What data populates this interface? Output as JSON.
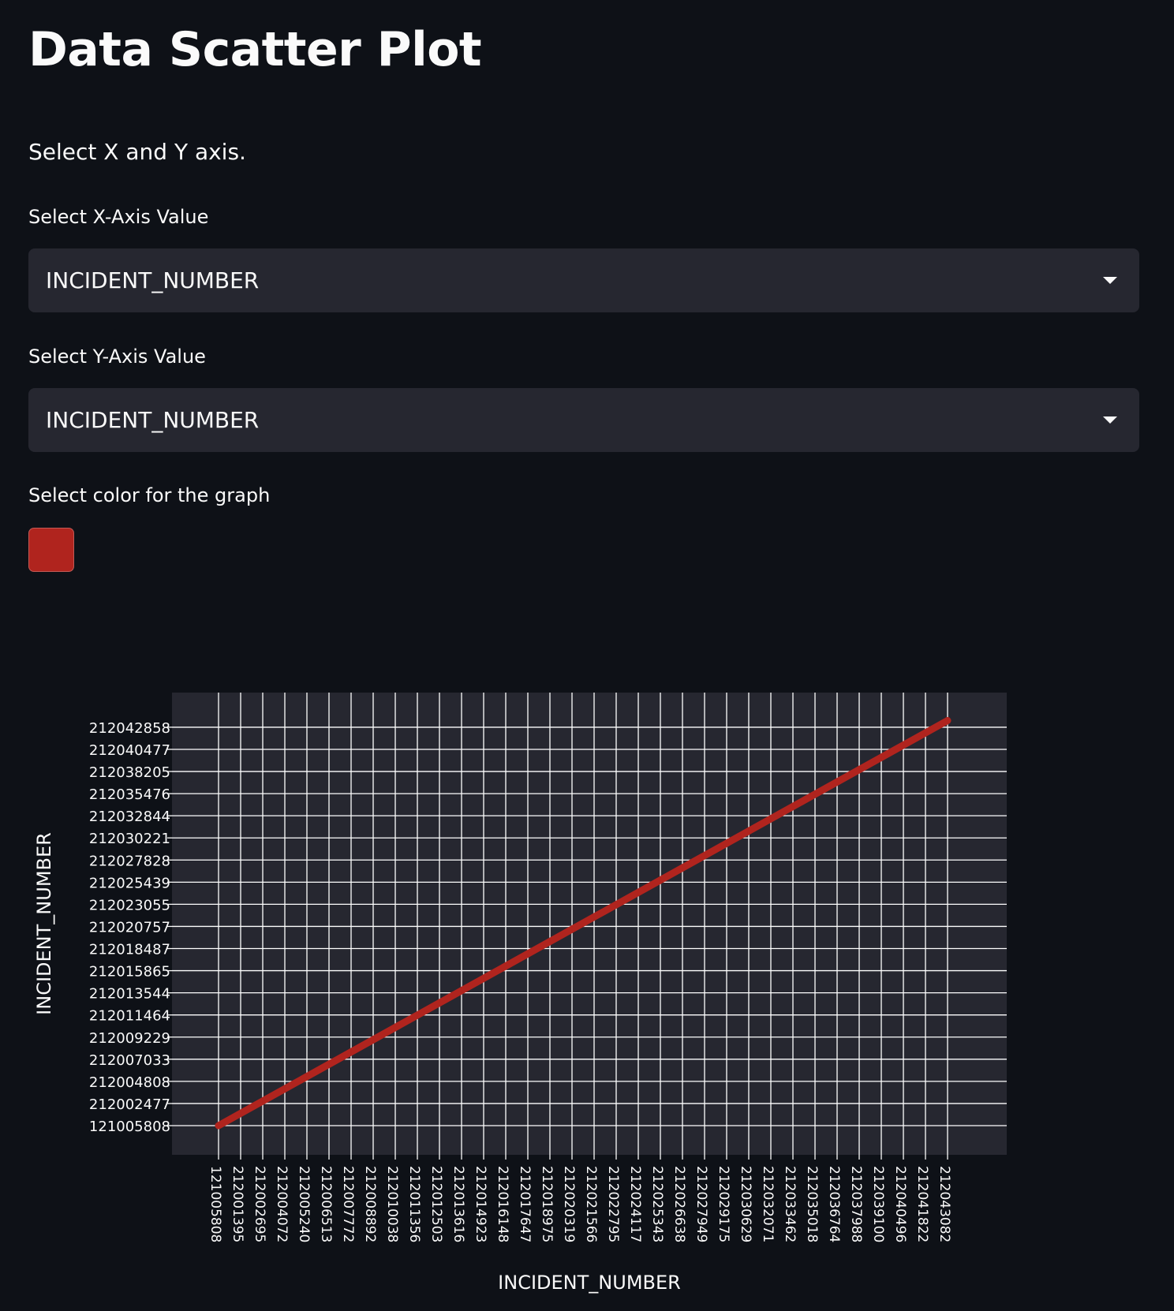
{
  "page": {
    "title": "Data Scatter Plot",
    "instruction": "Select X and Y axis."
  },
  "controls": {
    "x_axis": {
      "label": "Select X-Axis Value",
      "selected": "INCIDENT_NUMBER"
    },
    "y_axis": {
      "label": "Select Y-Axis Value",
      "selected": "INCIDENT_NUMBER"
    },
    "color": {
      "label": "Select color for the graph",
      "value": "#b0241e"
    },
    "chevron_icon": "chevron-down-icon"
  },
  "colors": {
    "background": "#0e1117",
    "panel": "#262730",
    "text": "#fafafa",
    "grid": "#ffffff",
    "series": "#b0241e"
  },
  "chart_data": {
    "type": "line",
    "xlabel": "INCIDENT_NUMBER",
    "ylabel": "INCIDENT_NUMBER",
    "grid": true,
    "legend": "none",
    "x_categories": [
      "121005808",
      "212001395",
      "212002695",
      "212004072",
      "212005240",
      "212006513",
      "212007772",
      "212008892",
      "212010038",
      "212011356",
      "212012503",
      "212013616",
      "212014923",
      "212016148",
      "212017647",
      "212018975",
      "212020319",
      "212021566",
      "212022795",
      "212024117",
      "212025343",
      "212026638",
      "212027949",
      "212029175",
      "212030629",
      "212032071",
      "212033462",
      "212035018",
      "212036764",
      "212037988",
      "212039100",
      "212040496",
      "212041822",
      "212043082"
    ],
    "y_categories": [
      "121005808",
      "212002477",
      "212004808",
      "212007033",
      "212009229",
      "212011464",
      "212013544",
      "212015865",
      "212018487",
      "212020757",
      "212023055",
      "212025439",
      "212027828",
      "212030221",
      "212032844",
      "212035476",
      "212038205",
      "212040477",
      "212042858"
    ],
    "series": [
      {
        "x_index": [
          0,
          33
        ],
        "y_index": [
          0,
          18.3
        ]
      }
    ]
  }
}
